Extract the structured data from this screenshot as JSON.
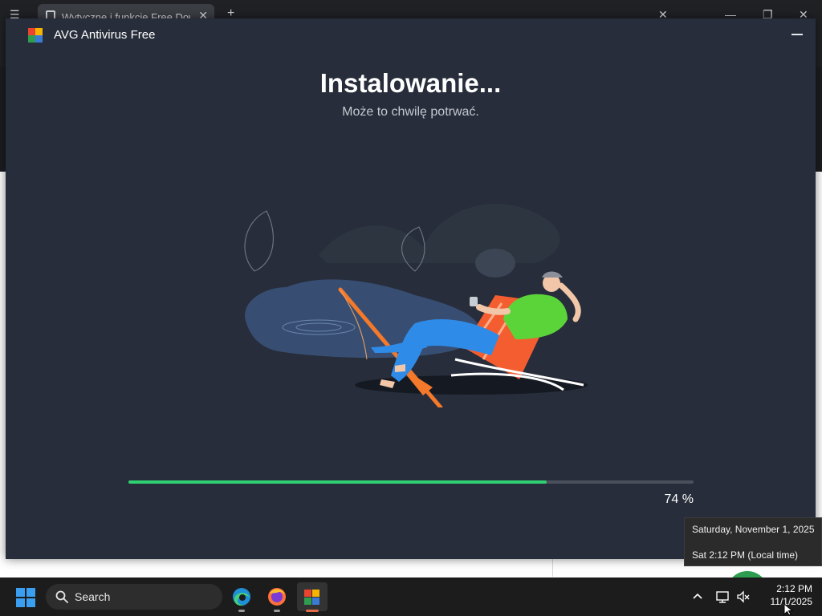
{
  "browser": {
    "tab_title": "Wytyczne i funkcje Free Download",
    "new_tab": "+"
  },
  "installer": {
    "app_title": "AVG Antivirus Free",
    "heading": "Instalowanie...",
    "subheading": "Może to chwilę potrwać.",
    "progress_percent": 74,
    "progress_text": "74 %",
    "accent_color": "#2fcf72",
    "background_color": "#272d3a",
    "logo_colors": [
      "#e8442e",
      "#f4b400",
      "#2e9d4f",
      "#3a7bd5"
    ]
  },
  "tooltip": {
    "date_full": "Saturday, November 1, 2025",
    "time_local": "Sat 2:12 PM (Local time)"
  },
  "taskbar": {
    "search_label": "Search",
    "apps": [
      "edge-icon",
      "firefox-icon",
      "avg-installer-icon"
    ],
    "tray_icons": [
      "chevron-up-icon",
      "network-icon",
      "volume-muted-icon"
    ],
    "clock_time": "2:12 PM",
    "clock_date": "11/1/2025"
  }
}
